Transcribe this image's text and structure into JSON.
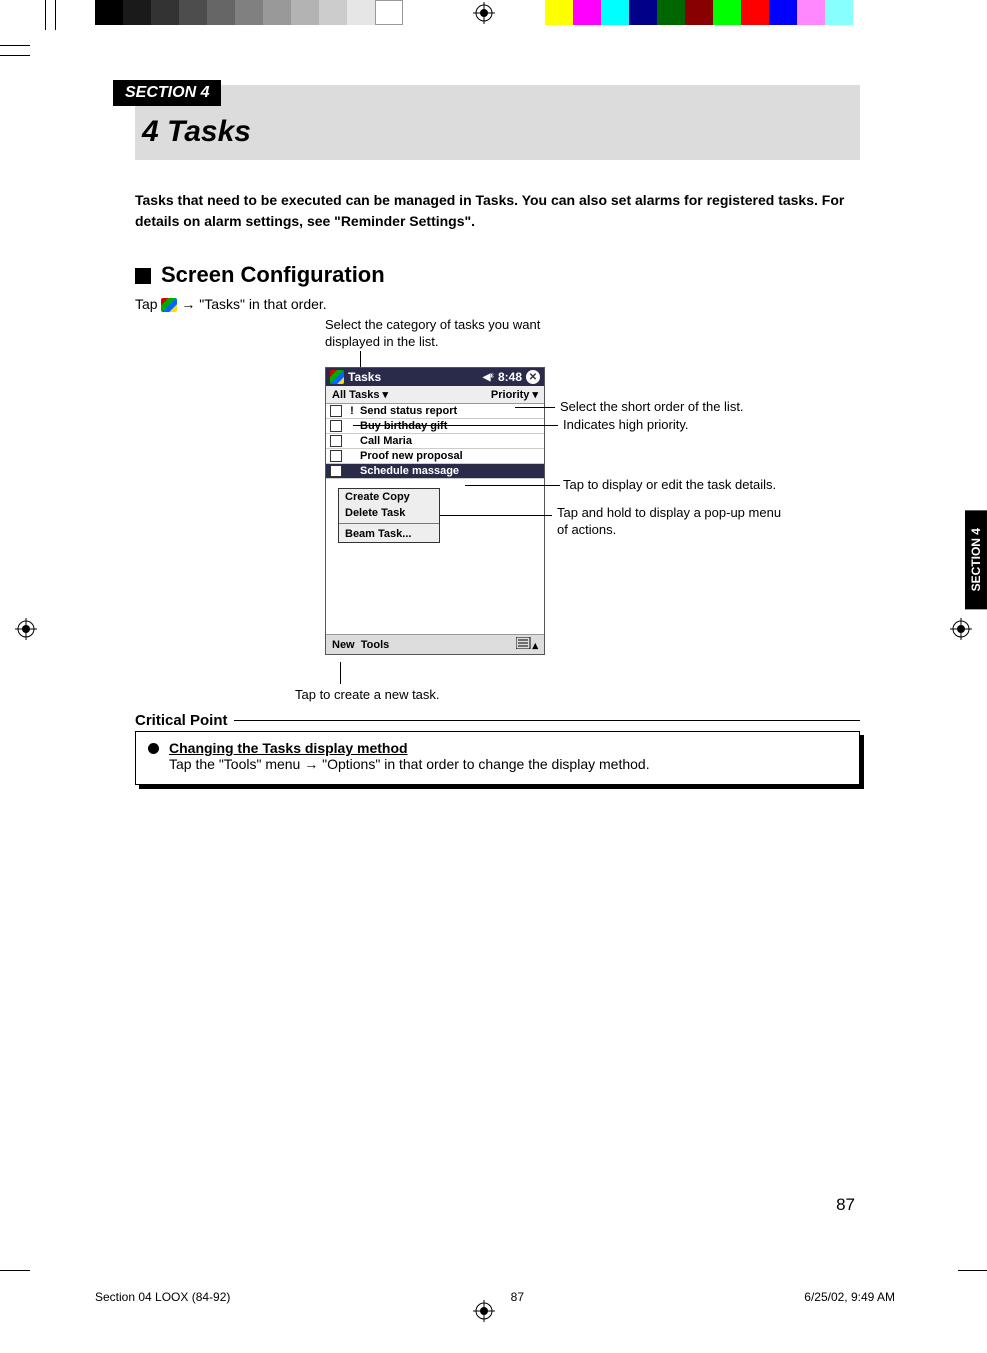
{
  "section_tag": "SECTION 4",
  "chapter": "4   Tasks",
  "intro": "Tasks that need to be executed can be managed in Tasks. You can also set alarms for registered tasks. For details on alarm settings, see \"Reminder Settings\".",
  "h2": "Screen Configuration",
  "tap_line_pre": "Tap ",
  "tap_line_post": " → \"Tasks\" in that order.",
  "annotations": {
    "category": "Select the category of tasks you want displayed in the list.",
    "sort": "Select the short order of the list.",
    "priority": "Indicates  high priority.",
    "details": "Tap to display or edit the task details.",
    "popup": "Tap and hold to display a pop-up menu of actions.",
    "newtask": "Tap to create a new task."
  },
  "device": {
    "title": "Tasks",
    "time_icon": "◀ξ",
    "time": "8:48",
    "filter": "All Tasks ▾",
    "sort": "Priority ▾",
    "tasks": [
      {
        "pri": "!",
        "label": "Send status report",
        "sel": false
      },
      {
        "pri": "",
        "label": "Buy birthday gift",
        "sel": false
      },
      {
        "pri": "",
        "label": "Call Maria",
        "sel": false
      },
      {
        "pri": "",
        "label": "Proof new proposal",
        "sel": false
      },
      {
        "pri": "",
        "label": "Schedule massage",
        "sel": true
      }
    ],
    "popup": [
      "Create Copy",
      "Delete Task",
      "Beam Task..."
    ],
    "new": "New",
    "tools": "Tools"
  },
  "critical": {
    "heading": "Critical Point",
    "title": "Changing the Tasks display method",
    "body": "Tap the \"Tools\" menu → \"Options\" in that order to change the display method."
  },
  "side_tab": "SECTION 4",
  "page_number": "87",
  "footer": {
    "left": "Section 04 LOOX (84-92)",
    "mid": "87",
    "right": "6/25/02, 9:49 AM"
  }
}
